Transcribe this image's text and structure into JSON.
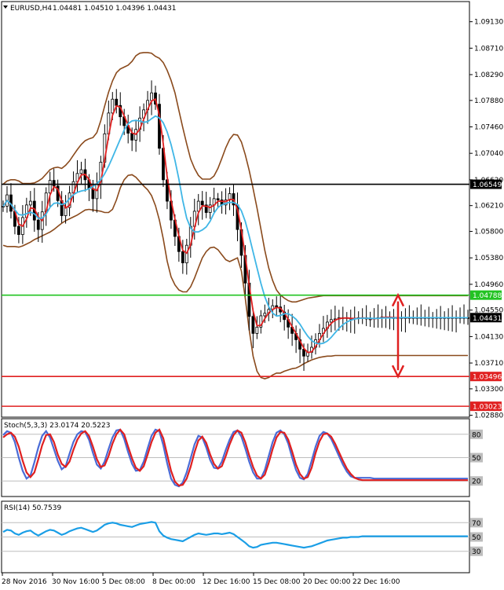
{
  "chart_data": [
    {
      "type": "line",
      "panel": "main",
      "title": "EURUSD,H4",
      "header_values": "1.04481 1.04510 1.04396 1.04431",
      "ylim": [
        1.0285,
        1.0945
      ],
      "y_ticks": [
        "1.09130",
        "1.08710",
        "1.08290",
        "1.07880",
        "1.07460",
        "1.07040",
        "1.06620",
        "1.06210",
        "1.05800",
        "1.05380",
        "1.04960",
        "1.04550",
        "1.04130",
        "1.03710",
        "1.03300",
        "1.02880"
      ],
      "x_labels": [
        "28 Nov 2016",
        "30 Nov 16:00",
        "5 Dec 08:00",
        "8 Dec 00:00",
        "12 Dec 16:00",
        "15 Dec 08:00",
        "20 Dec 00:00",
        "22 Dec 16:00"
      ],
      "bar_count": 120,
      "series": [
        {
          "label": "price_close",
          "values": [
            1.062,
            1.0638,
            1.0612,
            1.0588,
            1.0575,
            1.0602,
            1.0622,
            1.0628,
            1.0598,
            1.0583,
            1.0611,
            1.0641,
            1.0661,
            1.0652,
            1.0629,
            1.0605,
            1.0618,
            1.0641,
            1.0659,
            1.0672,
            1.0678,
            1.0662,
            1.0648,
            1.0632,
            1.0655,
            1.069,
            1.0735,
            1.0768,
            1.079,
            1.078,
            1.0762,
            1.0748,
            1.0736,
            1.0725,
            1.0742,
            1.076,
            1.0773,
            1.0788,
            1.08,
            1.0782,
            1.0712,
            1.0662,
            1.0628,
            1.0598,
            1.0572,
            1.0548,
            1.053,
            1.0558,
            1.0588,
            1.0612,
            1.0628,
            1.0622,
            1.061,
            1.0622,
            1.0632,
            1.063,
            1.0622,
            1.063,
            1.064,
            1.0622,
            1.0583,
            1.0542,
            1.0498,
            1.0445,
            1.0418,
            1.0428,
            1.0446,
            1.045,
            1.0456,
            1.0462,
            1.046,
            1.0452,
            1.044,
            1.0428,
            1.0418,
            1.0408,
            1.0393,
            1.0382,
            1.0388,
            1.0396,
            1.0408,
            1.0418,
            1.0426,
            1.0436,
            1.044,
            1.0441,
            1.0443,
            1.0443,
            1.0442,
            1.0441,
            1.0442,
            1.0443,
            1.0443,
            1.0441,
            1.0441,
            1.0442,
            1.0443,
            1.0444,
            1.0444,
            1.0443,
            1.0443,
            1.0443,
            1.0443,
            1.0443,
            1.0443,
            1.0443,
            1.0443,
            1.0443,
            1.0443,
            1.0443,
            1.0443,
            1.0443,
            1.0443,
            1.0443,
            1.0443,
            1.0443,
            1.0443,
            1.0443,
            1.0443,
            1.0443
          ]
        },
        {
          "label": "bb_upper",
          "values": [
            1.0655,
            1.066,
            1.0662,
            1.0662,
            1.066,
            1.0656,
            1.0656,
            1.0656,
            1.0657,
            1.066,
            1.0664,
            1.0671,
            1.0678,
            1.0681,
            1.0682,
            1.068,
            1.0685,
            1.0692,
            1.0701,
            1.071,
            1.0718,
            1.0724,
            1.0727,
            1.0729,
            1.0737,
            1.0756,
            1.0779,
            1.0801,
            1.0819,
            1.0832,
            1.0838,
            1.0841,
            1.0844,
            1.085,
            1.0859,
            1.0863,
            1.0864,
            1.0864,
            1.0863,
            1.0858,
            1.0855,
            1.0848,
            1.0836,
            1.082,
            1.08,
            1.0772,
            1.0745,
            1.0719,
            1.0695,
            1.068,
            1.0669,
            1.0663,
            1.0663,
            1.0663,
            1.0668,
            1.068,
            1.0696,
            1.0713,
            1.0726,
            1.0734,
            1.0733,
            1.0722,
            1.0702,
            1.0677,
            1.0648,
            1.0617,
            1.0584,
            1.055,
            1.0522,
            1.0502,
            1.0487,
            1.0479,
            1.0474,
            1.047,
            1.0468,
            1.0468,
            1.047,
            1.0472,
            1.0474,
            1.0475,
            1.0476,
            1.0477,
            1.0478,
            1.0478,
            1.0478,
            1.0478,
            1.0478,
            1.0478,
            1.0478,
            1.0478,
            1.0478,
            1.0478,
            1.0478,
            1.0478,
            1.0478,
            1.0478,
            1.0478,
            1.0478,
            1.0478,
            1.0478,
            1.0478,
            1.0478,
            1.0478,
            1.0478,
            1.0478,
            1.0478,
            1.0478,
            1.0478,
            1.0478,
            1.0478,
            1.0478,
            1.0478,
            1.0478,
            1.0478,
            1.0478,
            1.0478,
            1.0478,
            1.0478,
            1.0478,
            1.0478
          ]
        },
        {
          "label": "bb_lower",
          "values": [
            1.0558,
            1.0556,
            1.0556,
            1.0556,
            1.0555,
            1.0557,
            1.056,
            1.0563,
            1.0567,
            1.057,
            1.0573,
            1.0576,
            1.0579,
            1.0583,
            1.0588,
            1.0593,
            1.0597,
            1.06,
            1.0603,
            1.0606,
            1.061,
            1.0614,
            1.0615,
            1.0614,
            1.0613,
            1.0612,
            1.061,
            1.061,
            1.0615,
            1.063,
            1.0649,
            1.0662,
            1.0669,
            1.067,
            1.0666,
            1.0659,
            1.0652,
            1.0646,
            1.0637,
            1.0621,
            1.0598,
            1.0568,
            1.0533,
            1.0508,
            1.0495,
            1.0487,
            1.0484,
            1.0484,
            1.0492,
            1.0506,
            1.0522,
            1.0538,
            1.0548,
            1.0554,
            1.0555,
            1.0551,
            1.0543,
            1.0535,
            1.0532,
            1.0535,
            1.0538,
            1.0517,
            1.0474,
            1.0424,
            1.0382,
            1.0358,
            1.0348,
            1.0346,
            1.0348,
            1.0352,
            1.0355,
            1.0355,
            1.0358,
            1.036,
            1.0362,
            1.0363,
            1.0366,
            1.037,
            1.0373,
            1.0376,
            1.0378,
            1.038,
            1.0381,
            1.0382,
            1.0382,
            1.0383,
            1.0383,
            1.0383,
            1.0383,
            1.0383,
            1.0383,
            1.0383,
            1.0383,
            1.0383,
            1.0383,
            1.0383,
            1.0383,
            1.0383,
            1.0383,
            1.0383,
            1.0383,
            1.0383,
            1.0383,
            1.0383,
            1.0383,
            1.0383,
            1.0383,
            1.0383,
            1.0383,
            1.0383,
            1.0383,
            1.0383,
            1.0383,
            1.0383,
            1.0383,
            1.0383,
            1.0383,
            1.0383,
            1.0383,
            1.0383
          ]
        }
      ],
      "horizontal_levels": [
        {
          "value": 1.06549,
          "label": "1.06549",
          "color": "#000000"
        },
        {
          "value": 1.04788,
          "label": "1.04788",
          "color": "#22c322"
        },
        {
          "value": 1.04431,
          "label": "1.04431",
          "color": "#000000"
        },
        {
          "value": 1.03496,
          "label": "1.03496",
          "color": "#e02020"
        },
        {
          "value": 1.03023,
          "label": "1.03023",
          "color": "#e02020"
        }
      ],
      "arrow": {
        "from": 1.04788,
        "to": 1.03496,
        "color": "#e02020"
      }
    },
    {
      "type": "line",
      "panel": "stochastic",
      "title": "Stoch(5,3,3) 23.0174 20.5223",
      "ylim": [
        0,
        100
      ],
      "y_ticks": [
        "80",
        "50",
        "20"
      ],
      "series": [
        {
          "label": "main",
          "color": "#4a6bd6",
          "values": [
            79,
            84,
            82,
            70,
            50,
            33,
            23,
            27,
            44,
            63,
            78,
            84,
            76,
            61,
            46,
            35,
            39,
            55,
            70,
            80,
            84,
            83,
            73,
            56,
            41,
            36,
            45,
            61,
            76,
            85,
            86,
            74,
            57,
            42,
            33,
            34,
            45,
            62,
            78,
            86,
            84,
            66,
            43,
            23,
            15,
            13,
            18,
            31,
            49,
            67,
            78,
            76,
            63,
            47,
            37,
            36,
            45,
            60,
            73,
            83,
            85,
            77,
            62,
            45,
            31,
            23,
            23,
            34,
            52,
            70,
            82,
            85,
            80,
            68,
            50,
            34,
            24,
            22,
            29,
            46,
            64,
            78,
            83,
            81,
            74,
            63,
            52,
            41,
            32,
            26,
            24,
            24,
            24,
            24,
            24,
            23,
            23,
            23,
            23,
            23,
            23,
            23,
            23,
            23,
            23,
            23,
            23,
            23,
            23,
            23,
            23,
            23,
            23,
            23,
            23,
            23,
            23,
            23,
            23,
            23
          ]
        },
        {
          "label": "signal",
          "color": "#e02020",
          "values": [
            76,
            80,
            82,
            77,
            64,
            46,
            31,
            25,
            31,
            48,
            66,
            79,
            80,
            70,
            54,
            42,
            38,
            45,
            60,
            73,
            81,
            84,
            78,
            64,
            48,
            38,
            40,
            52,
            68,
            80,
            86,
            80,
            64,
            49,
            37,
            33,
            39,
            54,
            70,
            82,
            86,
            75,
            54,
            33,
            19,
            14,
            15,
            23,
            38,
            57,
            72,
            77,
            69,
            54,
            42,
            36,
            39,
            52,
            67,
            79,
            85,
            82,
            70,
            53,
            38,
            27,
            23,
            28,
            43,
            61,
            76,
            83,
            82,
            73,
            58,
            41,
            29,
            23,
            25,
            37,
            56,
            71,
            80,
            81,
            77,
            68,
            57,
            46,
            36,
            29,
            24,
            22,
            21,
            21,
            21,
            21,
            21,
            21,
            21,
            21,
            21,
            21,
            21,
            21,
            21,
            21,
            21,
            21,
            21,
            21,
            21,
            21,
            21,
            21,
            21,
            21,
            21,
            21,
            21,
            21
          ]
        }
      ]
    },
    {
      "type": "line",
      "panel": "rsi",
      "title": "RSI(14) 50.7539",
      "ylim": [
        0,
        100
      ],
      "y_ticks": [
        "70",
        "50",
        "30"
      ],
      "series": [
        {
          "label": "rsi",
          "color": "#1a9ee6",
          "values": [
            57,
            60,
            59,
            55,
            53,
            56,
            58,
            59,
            55,
            52,
            55,
            58,
            60,
            59,
            56,
            53,
            55,
            58,
            60,
            62,
            63,
            61,
            59,
            57,
            59,
            63,
            67,
            69,
            70,
            69,
            67,
            66,
            65,
            64,
            66,
            68,
            69,
            70,
            71,
            70,
            58,
            52,
            49,
            47,
            46,
            45,
            44,
            47,
            50,
            53,
            55,
            54,
            53,
            54,
            55,
            55,
            54,
            55,
            56,
            54,
            50,
            46,
            42,
            37,
            35,
            36,
            39,
            40,
            41,
            42,
            42,
            41,
            40,
            39,
            38,
            37,
            36,
            35,
            36,
            37,
            39,
            41,
            43,
            45,
            46,
            47,
            48,
            49,
            49,
            50,
            50,
            50,
            51,
            51,
            51,
            51,
            51,
            51,
            51,
            51,
            51,
            51,
            51,
            51,
            51,
            51,
            51,
            51,
            51,
            51,
            51,
            51,
            51,
            51,
            51,
            51,
            51,
            51,
            51,
            51
          ]
        }
      ]
    }
  ]
}
